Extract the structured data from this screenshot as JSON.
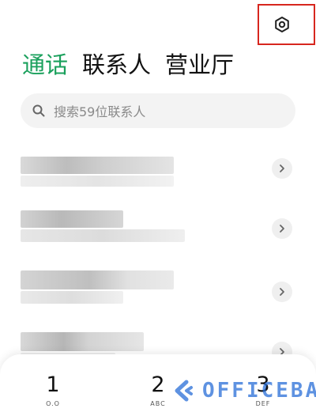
{
  "tabs": [
    {
      "label": "通话",
      "active": true
    },
    {
      "label": "联系人",
      "active": false
    },
    {
      "label": "营业厅",
      "active": false
    }
  ],
  "search": {
    "placeholder": "搜索59位联系人",
    "icon": "search-icon"
  },
  "settings": {
    "icon": "settings-icon"
  },
  "contacts": [
    {
      "name": "",
      "detail": ""
    },
    {
      "name": "",
      "detail": ""
    },
    {
      "name": "",
      "detail": ""
    },
    {
      "name": "",
      "detail": ""
    }
  ],
  "dialpad": {
    "keys": [
      {
        "digit": "1",
        "letters": "O.O"
      },
      {
        "digit": "2",
        "letters": "ABC"
      },
      {
        "digit": "3",
        "letters": "DEF"
      }
    ]
  },
  "watermark": {
    "text": "OFFICEBA"
  },
  "colors": {
    "accent": "#1aa05c",
    "highlight": "#d7261e",
    "watermark": "#286ed7"
  }
}
